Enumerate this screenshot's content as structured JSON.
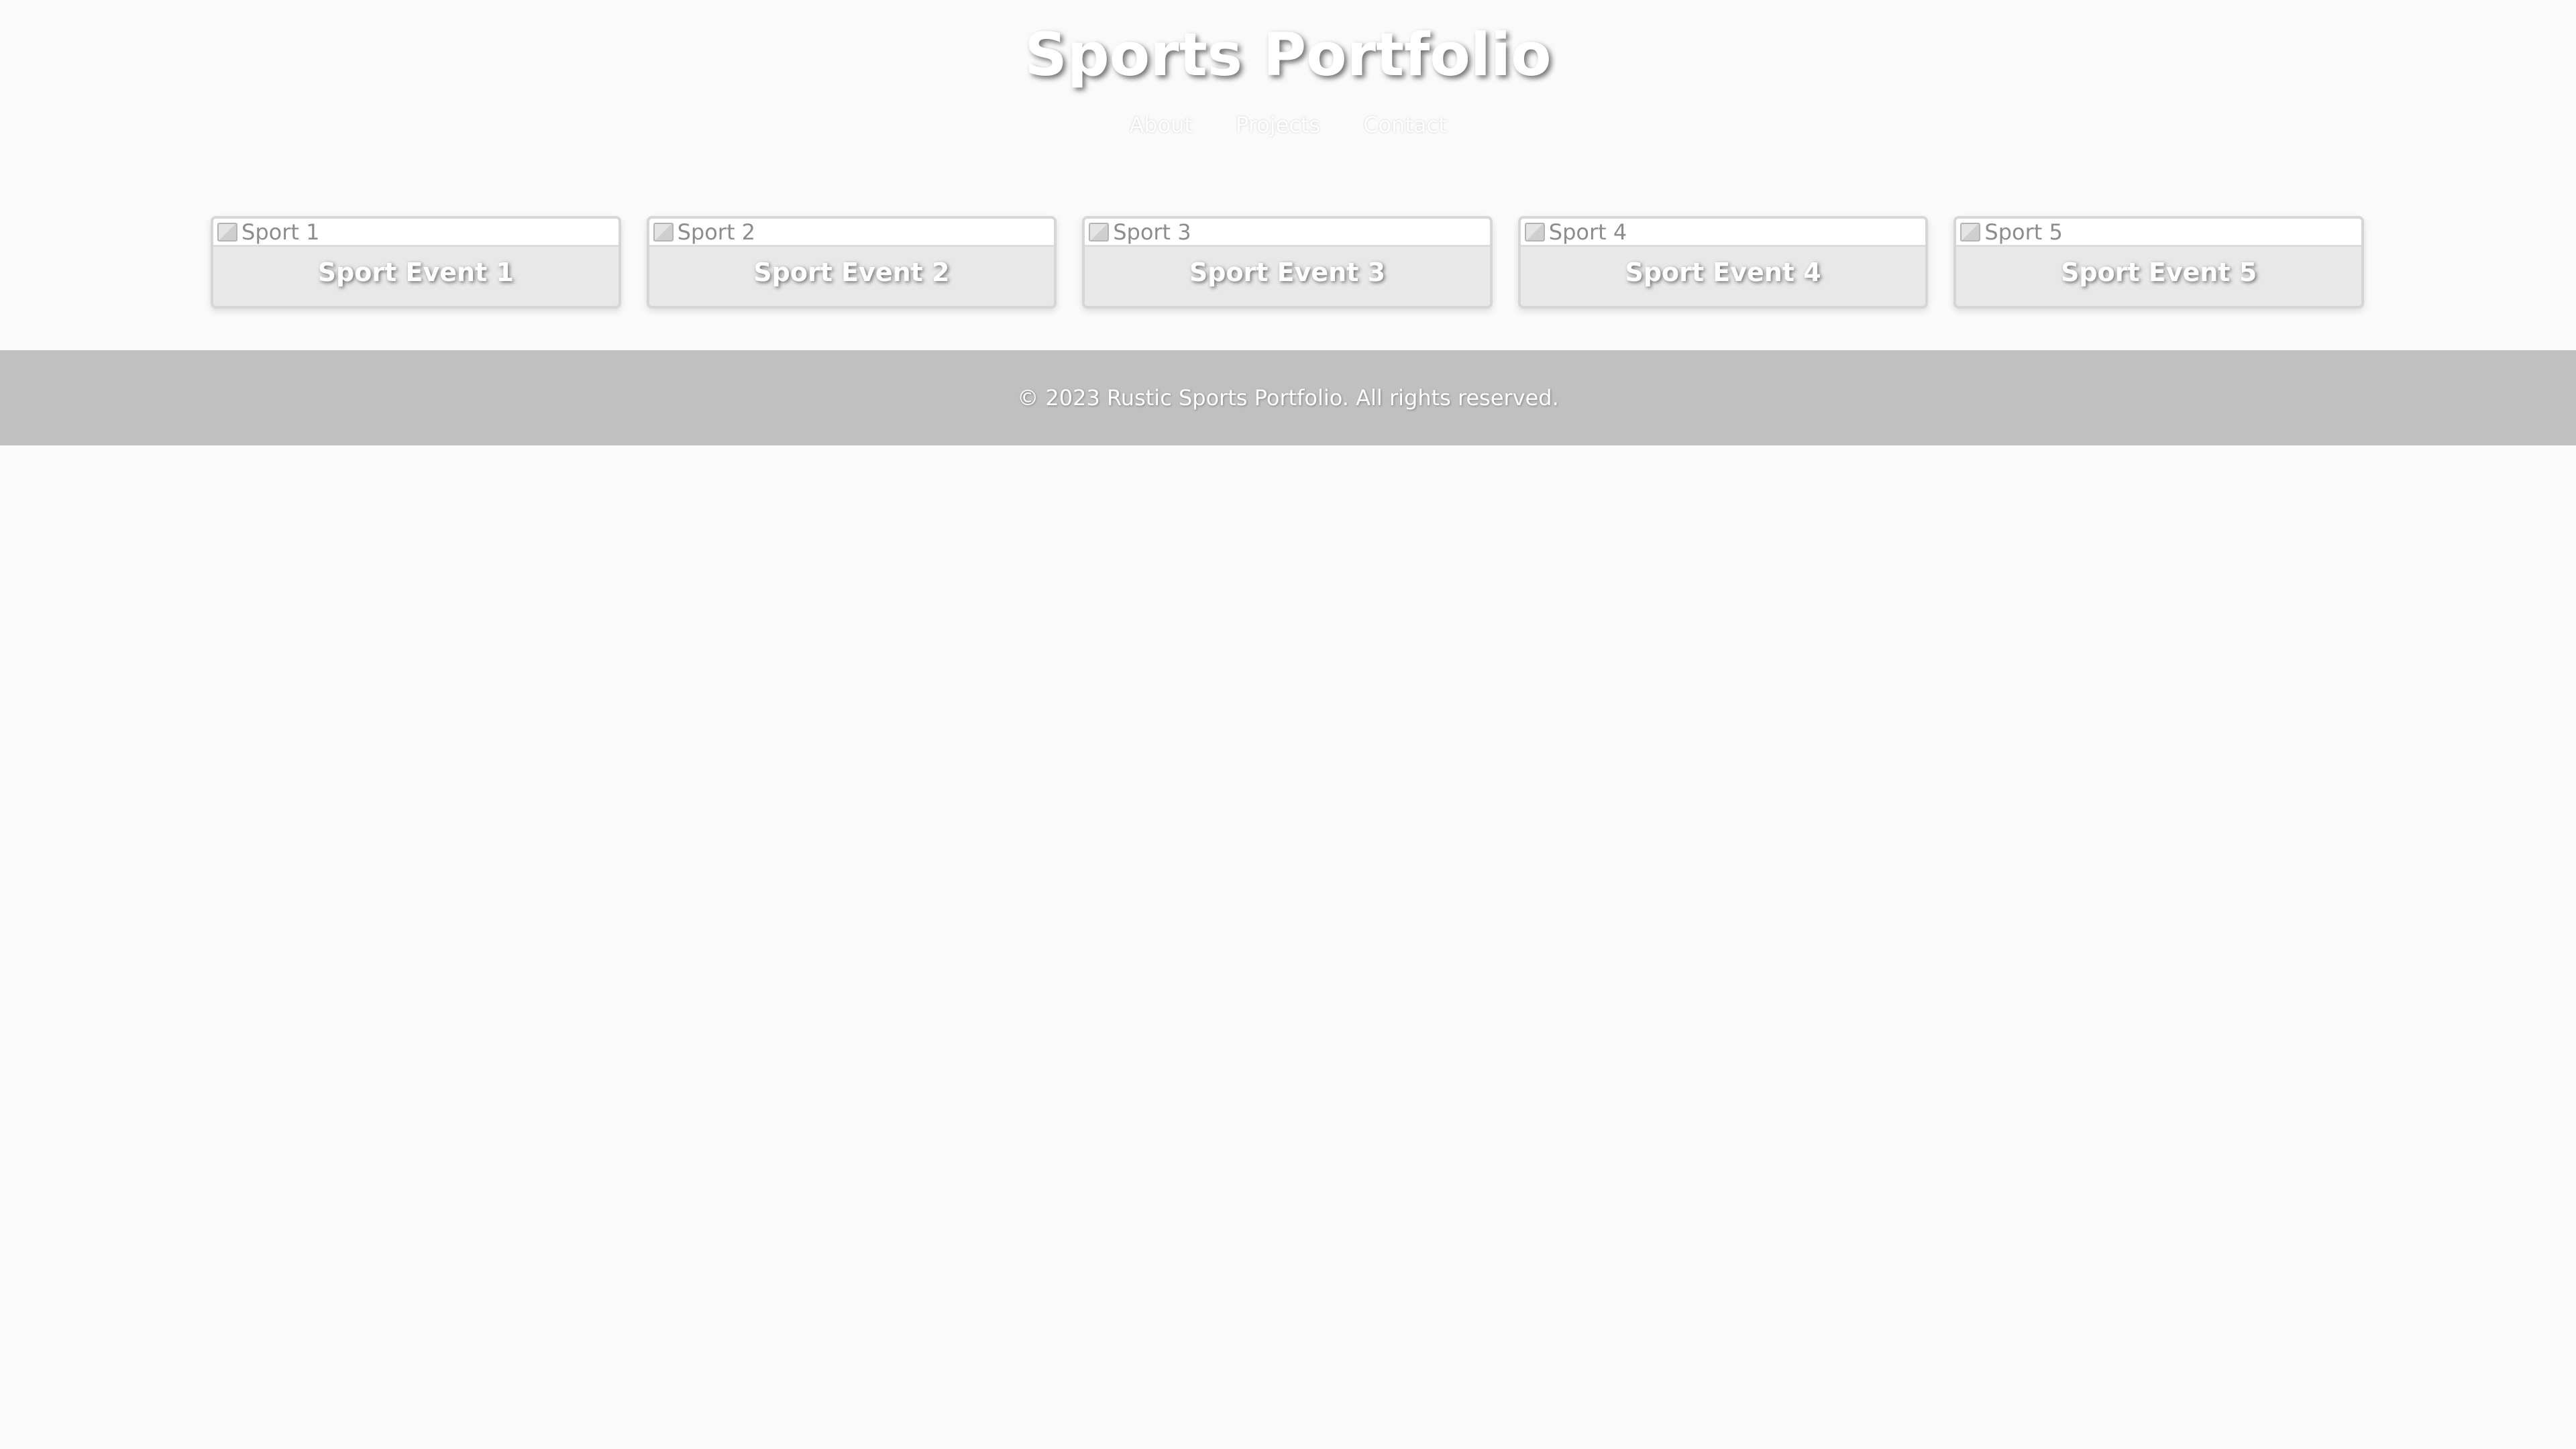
{
  "header": {
    "title": "Sports Portfolio",
    "nav": [
      {
        "label": "About"
      },
      {
        "label": "Projects"
      },
      {
        "label": "Contact"
      }
    ]
  },
  "gallery": {
    "cards": [
      {
        "img_alt": "Sport 1",
        "title": "Sport Event 1"
      },
      {
        "img_alt": "Sport 2",
        "title": "Sport Event 2"
      },
      {
        "img_alt": "Sport 3",
        "title": "Sport Event 3"
      },
      {
        "img_alt": "Sport 4",
        "title": "Sport Event 4"
      },
      {
        "img_alt": "Sport 5",
        "title": "Sport Event 5"
      }
    ]
  },
  "footer": {
    "text": "© 2023 Rustic Sports Portfolio. All rights reserved."
  },
  "colors": {
    "background": "#fafafa",
    "card": "#e8e8e8",
    "footer": "#c0c0c0",
    "text": "#ffffff"
  }
}
